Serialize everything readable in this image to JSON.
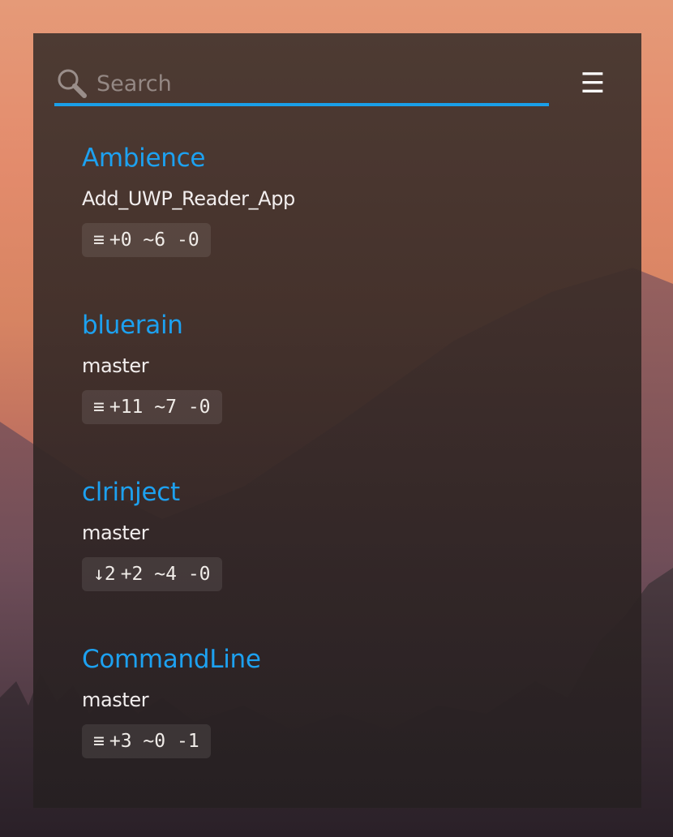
{
  "search": {
    "placeholder": "Search",
    "value": ""
  },
  "menu": {
    "icon": "hamburger-menu-icon",
    "glyph": "☰"
  },
  "accent_color": "#1a9fe8",
  "repos": [
    {
      "name": "Ambience",
      "branch": "Add_UWP_Reader_App",
      "sync": "≡",
      "added": "+0",
      "modified": "~6",
      "deleted": "-0"
    },
    {
      "name": "bluerain",
      "branch": "master",
      "sync": "≡",
      "added": "+11",
      "modified": "~7",
      "deleted": "-0"
    },
    {
      "name": "clrinject",
      "branch": "master",
      "sync": "↓2",
      "added": "+2",
      "modified": "~4",
      "deleted": "-0"
    },
    {
      "name": "CommandLine",
      "branch": "master",
      "sync": "≡",
      "added": "+3",
      "modified": "~0",
      "deleted": "-1"
    }
  ]
}
